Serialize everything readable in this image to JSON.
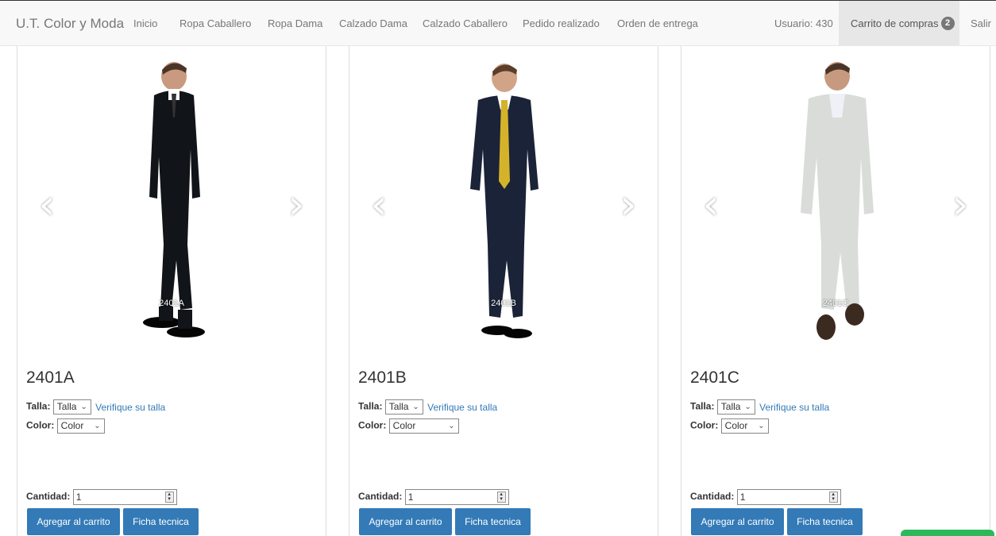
{
  "navbar": {
    "brand": "U.T. Color y Moda",
    "links": [
      "Inicio",
      "Ropa Caballero",
      "Ropa Dama",
      "Calzado Dama",
      "Calzado Caballero",
      "Pedido realizado",
      "Orden de entrega"
    ],
    "user": "Usuario: 430",
    "cart_label": "Carrito de compras",
    "cart_count": "2",
    "logout": "Salir"
  },
  "products": [
    {
      "code": "2401A",
      "caption": "2401A",
      "talla_label": "Talla:",
      "talla_value": "Talla",
      "verify_link": "Verifique su talla",
      "color_label": "Color:",
      "color_value": "Color",
      "qty_label": "Cantidad:",
      "qty_value": "1",
      "add_button": "Agregar al carrito",
      "sheet_button": "Ficha tecnica",
      "suit_color": "#111418"
    },
    {
      "code": "2401B",
      "caption": "2401B",
      "talla_label": "Talla:",
      "talla_value": "Talla",
      "verify_link": "Verifique su talla",
      "color_label": "Color:",
      "color_value": "Color",
      "qty_label": "Cantidad:",
      "qty_value": "1",
      "add_button": "Agregar al carrito",
      "sheet_button": "Ficha tecnica",
      "suit_color": "#1b2338"
    },
    {
      "code": "2401C",
      "caption": "2401C",
      "talla_label": "Talla:",
      "talla_value": "Talla",
      "verify_link": "Verifique su talla",
      "color_label": "Color:",
      "color_value": "Color",
      "qty_label": "Cantidad:",
      "qty_value": "1",
      "add_button": "Agregar al carrito",
      "sheet_button": "Ficha tecnica",
      "suit_color": "#d9dcd8"
    }
  ],
  "icons": {
    "prev": "chevron-left-icon",
    "next": "chevron-right-icon",
    "spinner": "number-spinner-icon",
    "dropdown": "chevron-down-icon"
  },
  "colors": {
    "primary_button": "#337ab7",
    "link": "#337ab7",
    "badge": "#777777",
    "navbar_bg": "#f8f8f8",
    "chat_tab": "#2eb85c"
  }
}
